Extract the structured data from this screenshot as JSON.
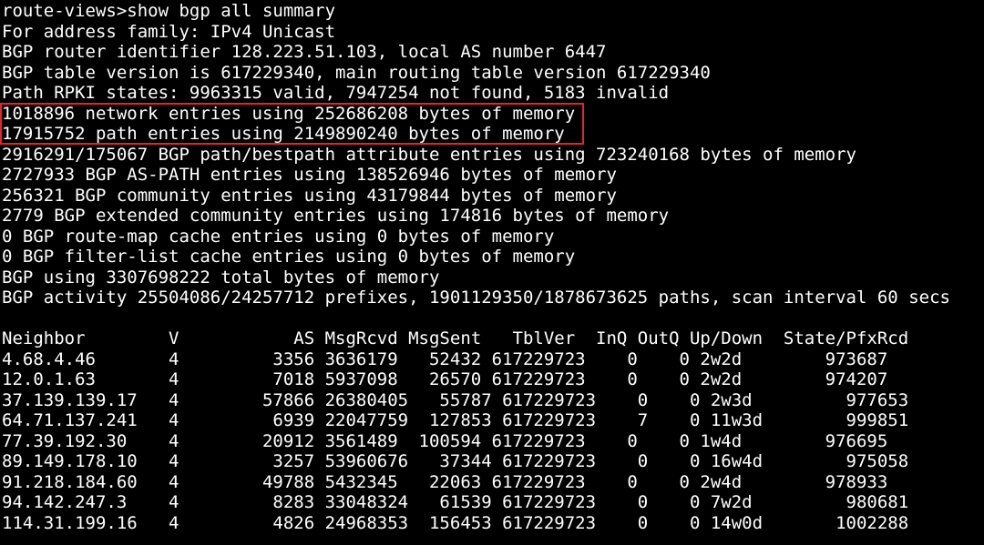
{
  "colors": {
    "background": "#000000",
    "text": "#ffffff",
    "highlight": "#e8242a"
  },
  "terminal": {
    "lines": [
      "route-views>show bgp all summary",
      "For address family: IPv4 Unicast",
      "BGP router identifier 128.223.51.103, local AS number 6447",
      "BGP table version is 617229340, main routing table version 617229340",
      "Path RPKI states: 9963315 valid, 7947254 not found, 5183 invalid",
      "1018896 network entries using 252686208 bytes of memory",
      "17915752 path entries using 2149890240 bytes of memory",
      "2916291/175067 BGP path/bestpath attribute entries using 723240168 bytes of memory",
      "2727933 BGP AS-PATH entries using 138526946 bytes of memory",
      "256321 BGP community entries using 43179844 bytes of memory",
      "2779 BGP extended community entries using 174816 bytes of memory",
      "0 BGP route-map cache entries using 0 bytes of memory",
      "0 BGP filter-list cache entries using 0 bytes of memory",
      "BGP using 3307698222 total bytes of memory",
      "BGP activity 25504086/24257712 prefixes, 1901129350/1878673625 paths, scan interval 60 secs",
      "",
      "Neighbor        V           AS MsgRcvd MsgSent   TblVer  InQ OutQ Up/Down  State/PfxRcd",
      "4.68.4.46       4         3356 3636179   52432 617229723    0    0 2w2d        973687",
      "12.0.1.63       4         7018 5937098   26570 617229723    0    0 2w2d        974207",
      "37.139.139.17   4        57866 26380405   55787 617229723    0    0 2w3d         977653",
      "64.71.137.241   4         6939 22047759  127853 617229723    7    0 11w3d        999851",
      "77.39.192.30    4        20912 3561489  100594 617229723    0    0 1w4d        976695",
      "89.149.178.10   4         3257 53960676   37344 617229723    0    0 16w4d        975058",
      "91.218.184.60   4        49788 5432345   22063 617229723    0    0 2w4d        978933",
      "94.142.247.3    4         8283 33048324   61539 617229723    0    0 7w2d         980681",
      "114.31.199.16   4         4826 24968353  156453 617229723    0    0 14w0d       1002288"
    ]
  }
}
